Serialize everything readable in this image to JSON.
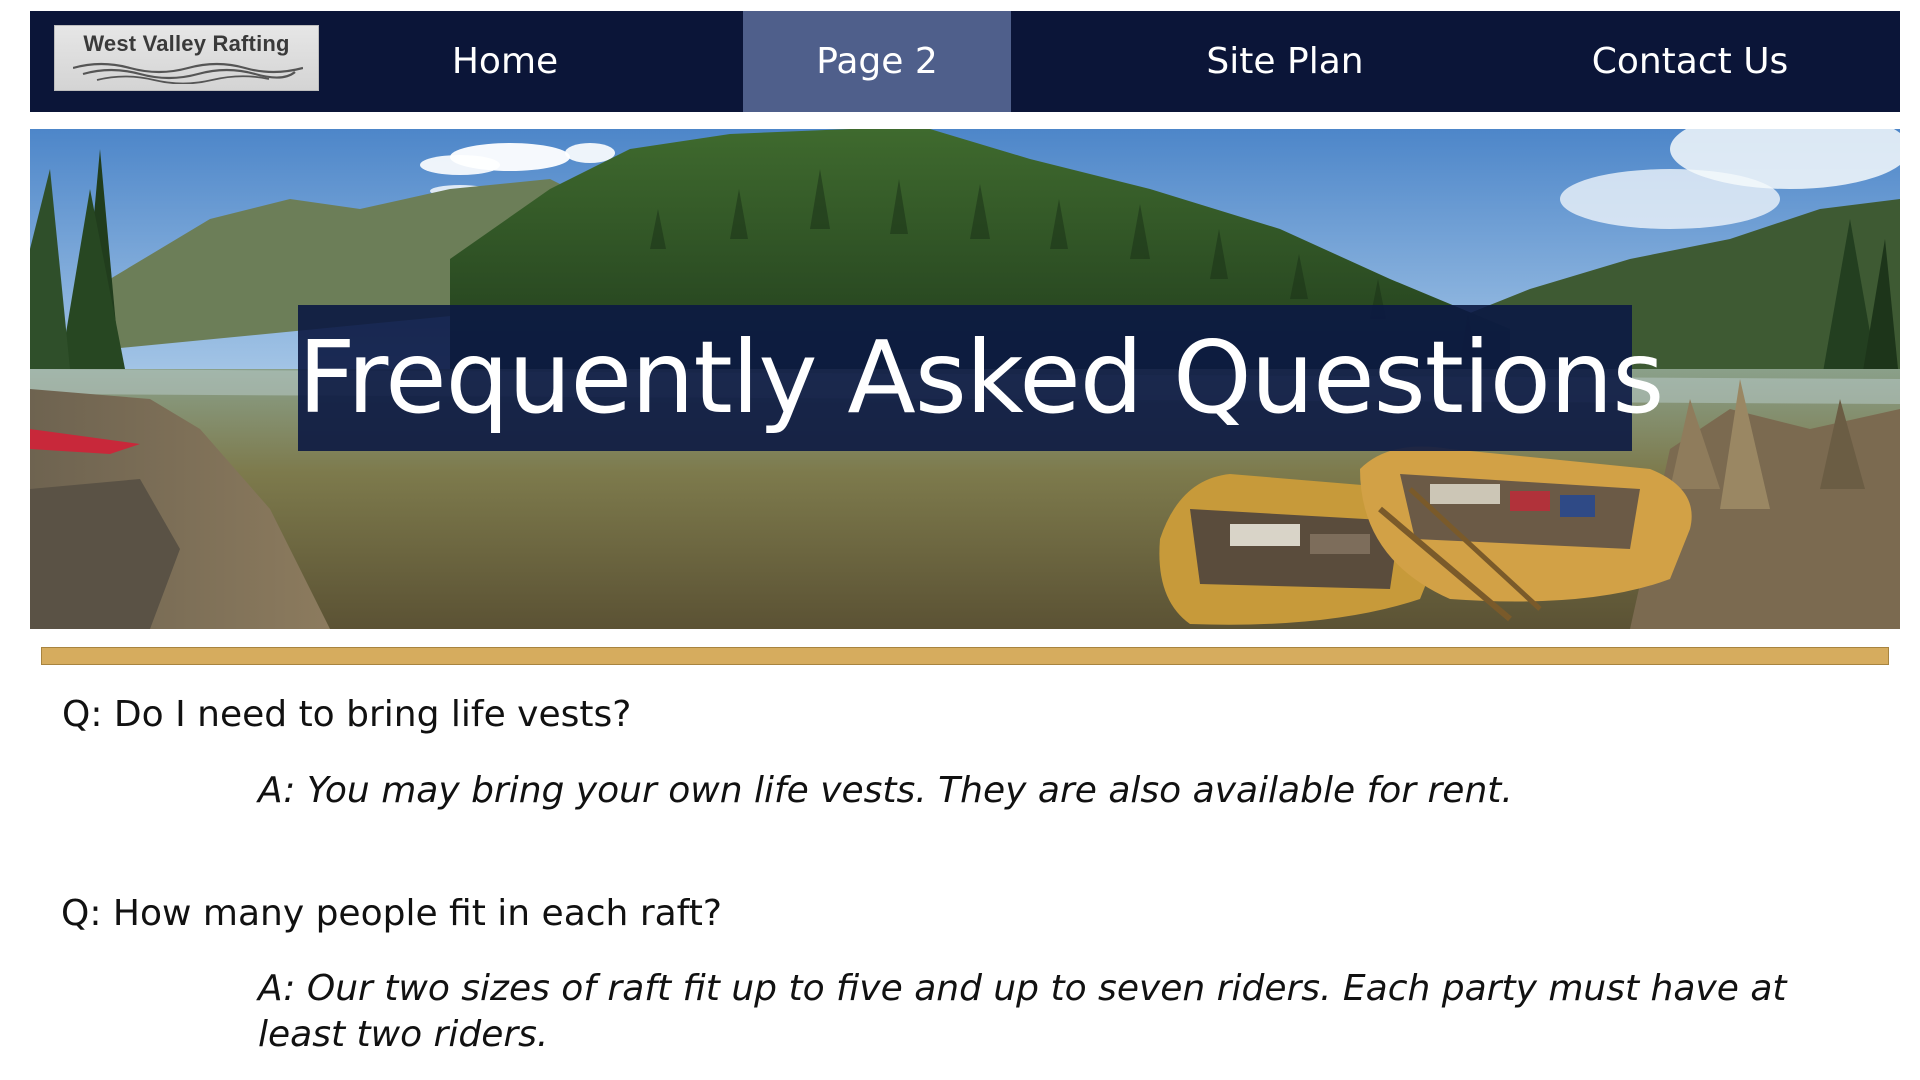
{
  "nav": {
    "logo_text": "West Valley Rafting",
    "items": [
      {
        "label": "Home",
        "active": false
      },
      {
        "label": "Page 2",
        "active": true
      },
      {
        "label": "Site Plan",
        "active": false
      },
      {
        "label": "Contact Us",
        "active": false
      }
    ]
  },
  "hero": {
    "title": "Frequently Asked Questions"
  },
  "faq": [
    {
      "question": "Q: Do I need to bring life vests?",
      "answer": "A: You may bring your own life vests. They are also available for rent."
    },
    {
      "question": "Q: How many people fit in each raft?",
      "answer": "A: Our two sizes of raft fit up to five and up to seven riders. Each party must have at least two riders."
    }
  ],
  "colors": {
    "nav_background": "#0b1538",
    "nav_active": "#4f5f8b",
    "title_box": "#0b1842",
    "gold_rule": "#d6ac5e"
  }
}
